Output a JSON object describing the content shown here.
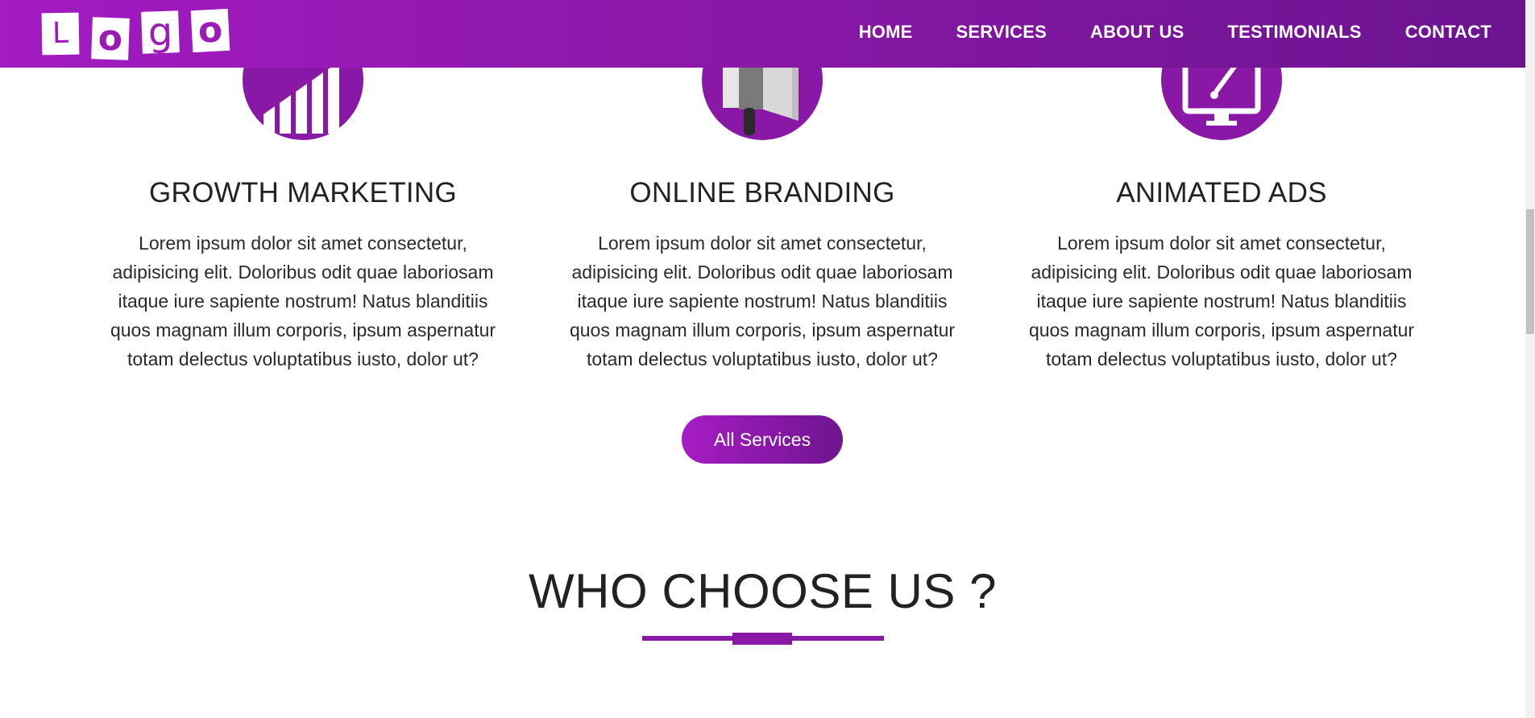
{
  "header": {
    "logo_letters": [
      "L",
      "o",
      "g",
      "o"
    ],
    "nav": [
      {
        "label": "HOME"
      },
      {
        "label": "SERVICES"
      },
      {
        "label": "ABOUT US"
      },
      {
        "label": "TESTIMONIALS"
      },
      {
        "label": "CONTACT"
      }
    ]
  },
  "services": [
    {
      "icon": "bar-chart-icon",
      "title": "GROWTH MARKETING",
      "description": "Lorem ipsum dolor sit amet consectetur, adipisicing elit. Doloribus odit quae laboriosam itaque iure sapiente nostrum! Natus blanditiis quos magnam illum corporis, ipsum aspernatur totam delectus voluptatibus iusto, dolor ut?"
    },
    {
      "icon": "megaphone-icon",
      "title": "ONLINE BRANDING",
      "description": "Lorem ipsum dolor sit amet consectetur, adipisicing elit. Doloribus odit quae laboriosam itaque iure sapiente nostrum! Natus blanditiis quos magnam illum corporis, ipsum aspernatur totam delectus voluptatibus iusto, dolor ut?"
    },
    {
      "icon": "monitor-brush-icon",
      "title": "ANIMATED ADS",
      "description": "Lorem ipsum dolor sit amet consectetur, adipisicing elit. Doloribus odit quae laboriosam itaque iure sapiente nostrum! Natus blanditiis quos magnam illum corporis, ipsum aspernatur totam delectus voluptatibus iusto, dolor ut?"
    }
  ],
  "all_services_button": "All Services",
  "section": {
    "title": "WHO CHOOSE US ?"
  },
  "colors": {
    "brand_purple": "#8a18a6",
    "gradient_start": "#a31bc2",
    "gradient_end": "#6b1490"
  }
}
